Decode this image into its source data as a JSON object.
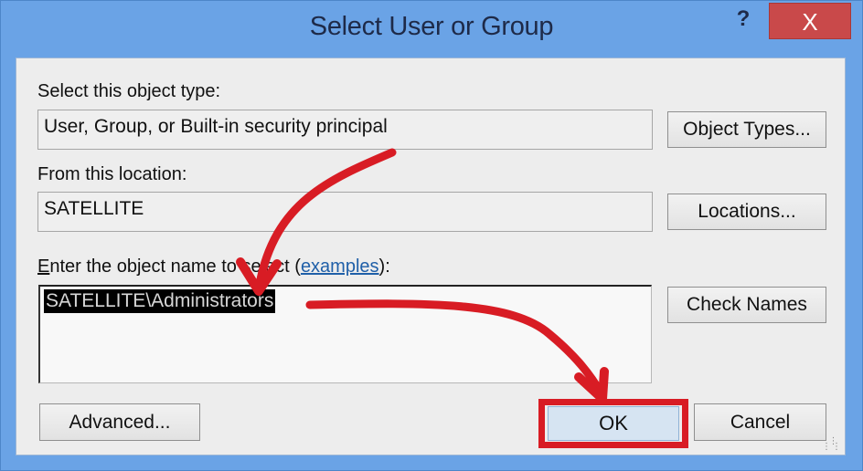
{
  "window": {
    "title": "Select User or Group",
    "help_label": "?",
    "close_label": "X"
  },
  "object_type": {
    "label": "Select this object type:",
    "value": "User, Group, or Built-in security principal",
    "button_label": "Object Types..."
  },
  "location": {
    "label": "From this location:",
    "value": "SATELLITE",
    "button_label": "Locations..."
  },
  "object_name": {
    "label_accel": "E",
    "label_rest": "nter the object name to select (",
    "link_label": "examples",
    "label_suffix": "):",
    "value": "SATELLITE\\Administrators",
    "check_names_label": "Check Names"
  },
  "footer": {
    "advanced_label": "Advanced...",
    "ok_label": "OK",
    "cancel_label": "Cancel"
  },
  "annotation": {
    "color": "#d81c24",
    "highlighted_target": "OK"
  }
}
